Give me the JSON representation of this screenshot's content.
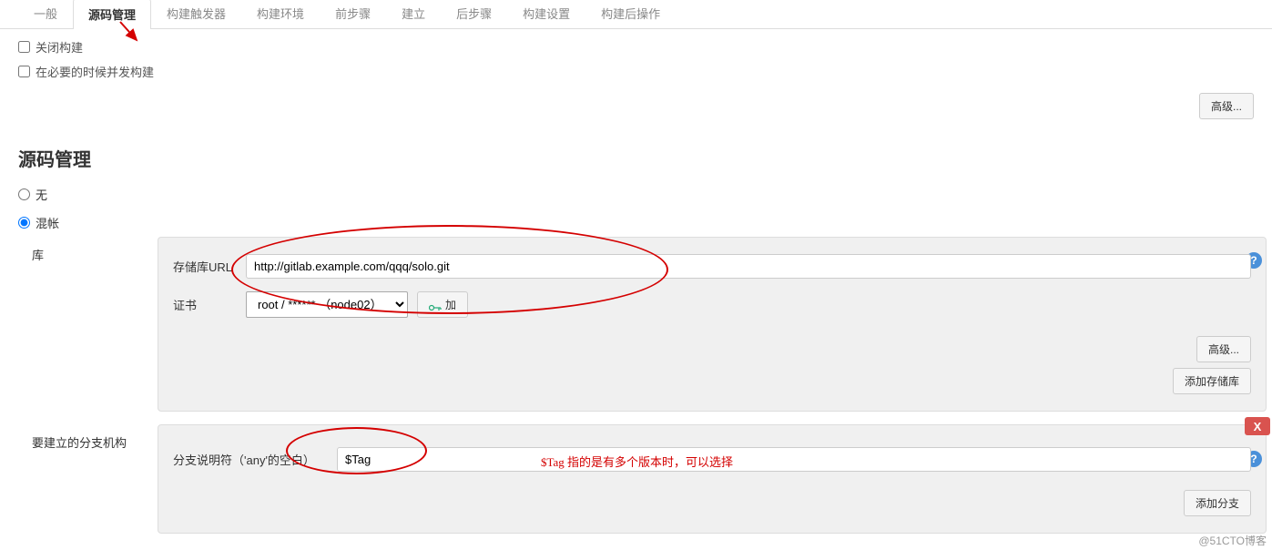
{
  "tabs": {
    "items": [
      {
        "label": "一般"
      },
      {
        "label": "源码管理"
      },
      {
        "label": "构建触发器"
      },
      {
        "label": "构建环境"
      },
      {
        "label": "前步骤"
      },
      {
        "label": "建立"
      },
      {
        "label": "后步骤"
      },
      {
        "label": "构建设置"
      },
      {
        "label": "构建后操作"
      }
    ],
    "active_index": 1
  },
  "general": {
    "chk_close_build": "关闭构建",
    "chk_concurrent": "在必要的时候并发构建",
    "advanced_btn": "高级..."
  },
  "scm": {
    "title": "源码管理",
    "radio_none": "无",
    "radio_git": "混帐",
    "repos_label": "库",
    "repo_url_label": "存储库URL",
    "repo_url_value": "http://gitlab.example.com/qqq/solo.git",
    "cred_label": "证书",
    "cred_selected": "root / ****** （node02）",
    "add_cred_btn": "加",
    "advanced_btn": "高级...",
    "add_repo_btn": "添加存储库",
    "branches_label": "要建立的分支机构",
    "branch_spec_label": "分支说明符（'any'的空白）",
    "branch_spec_value": "$Tag",
    "delete_badge": "X",
    "add_branch_btn": "添加分支"
  },
  "annotations": {
    "tag_note": "$Tag 指的是有多个版本时，可以选择"
  },
  "watermark": "@51CTO博客"
}
